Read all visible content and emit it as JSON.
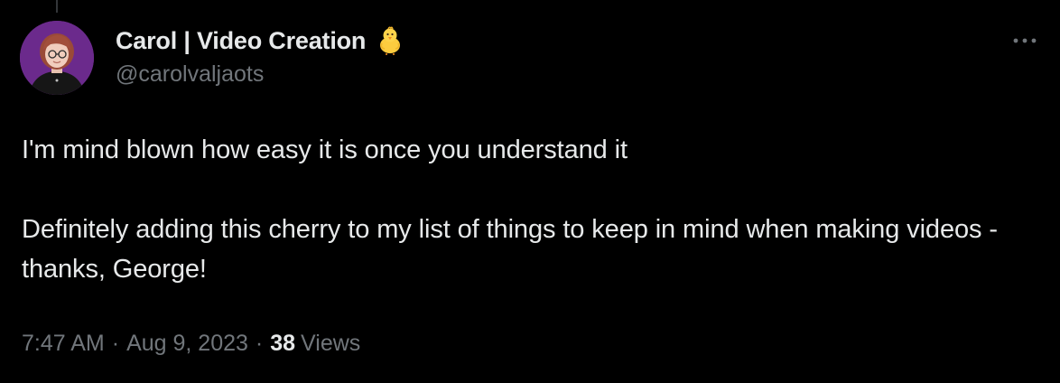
{
  "author": {
    "display_name": "Carol | Video Creation",
    "handle": "@carolvaljaots",
    "badge_icon": "baby-chick-icon",
    "avatar_bg": "#6b2a8c"
  },
  "menu": {
    "more_icon": "more-horizontal-icon"
  },
  "tweet": {
    "paragraphs": [
      "I'm mind blown how easy it is once you understand it",
      "Definitely adding this cherry to my list of things to keep in mind when making videos - thanks, George!"
    ],
    "time": "7:47 AM",
    "date": "Aug 9, 2023",
    "separator": "·",
    "views_count": "38",
    "views_label": "Views"
  },
  "colors": {
    "background": "#000000",
    "primary_text": "#e7e9ea",
    "secondary_text": "#71767b"
  }
}
